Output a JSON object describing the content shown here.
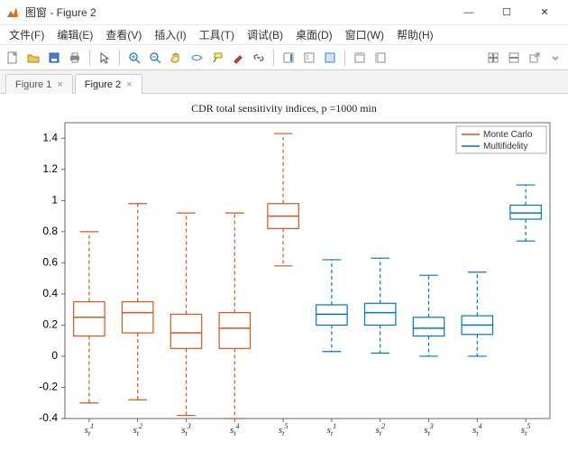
{
  "window": {
    "title": "图窗 - Figure 2",
    "min": "—",
    "max": "☐",
    "close": "✕"
  },
  "menu": {
    "file": "文件(F)",
    "edit": "编辑(E)",
    "view": "查看(V)",
    "insert": "插入(I)",
    "tools": "工具(T)",
    "debug": "调试(B)",
    "desktop": "桌面(D)",
    "window": "窗口(W)",
    "help": "帮助(H)"
  },
  "tabs": {
    "tab1": "Figure 1",
    "tab2": "Figure 2"
  },
  "legend": {
    "mc": "Monte Carlo",
    "mf": "Multifidelity"
  },
  "chart_data": {
    "type": "boxplot",
    "title": "CDR total sensitivity indices, p =1000 min",
    "ylabel": "",
    "xlabel": "",
    "ylim": [
      -0.4,
      1.5
    ],
    "yticks": [
      -0.4,
      -0.2,
      0,
      0.2,
      0.4,
      0.6,
      0.8,
      1,
      1.2,
      1.4
    ],
    "categories": [
      "s_t^1",
      "s_t^2",
      "s_t^3",
      "s_t^4",
      "s_t^5",
      "s_t^1",
      "s_t^2",
      "s_t^3",
      "s_t^4",
      "s_t^5"
    ],
    "series": [
      {
        "name": "Monte Carlo",
        "color": "#d9541e",
        "boxes": [
          {
            "x": 1,
            "whisker_low": -0.3,
            "q1": 0.13,
            "median": 0.25,
            "q3": 0.35,
            "whisker_high": 0.8
          },
          {
            "x": 2,
            "whisker_low": -0.28,
            "q1": 0.15,
            "median": 0.28,
            "q3": 0.35,
            "whisker_high": 0.98
          },
          {
            "x": 3,
            "whisker_low": -0.38,
            "q1": 0.05,
            "median": 0.15,
            "q3": 0.27,
            "whisker_high": 0.92
          },
          {
            "x": 4,
            "whisker_low": -0.4,
            "q1": 0.05,
            "median": 0.18,
            "q3": 0.28,
            "whisker_high": 0.92
          },
          {
            "x": 5,
            "whisker_low": 0.58,
            "q1": 0.82,
            "median": 0.9,
            "q3": 0.98,
            "whisker_high": 1.43
          }
        ]
      },
      {
        "name": "Multifidelity",
        "color": "#0076c0",
        "boxes": [
          {
            "x": 6,
            "whisker_low": 0.03,
            "q1": 0.2,
            "median": 0.27,
            "q3": 0.33,
            "whisker_high": 0.62
          },
          {
            "x": 7,
            "whisker_low": 0.02,
            "q1": 0.2,
            "median": 0.28,
            "q3": 0.34,
            "whisker_high": 0.63
          },
          {
            "x": 8,
            "whisker_low": 0.0,
            "q1": 0.13,
            "median": 0.18,
            "q3": 0.25,
            "whisker_high": 0.52
          },
          {
            "x": 9,
            "whisker_low": 0.0,
            "q1": 0.14,
            "median": 0.2,
            "q3": 0.26,
            "whisker_high": 0.54
          },
          {
            "x": 10,
            "whisker_low": 0.74,
            "q1": 0.88,
            "median": 0.92,
            "q3": 0.97,
            "whisker_high": 1.1
          }
        ]
      }
    ]
  },
  "colors": {
    "mc": "#d9541e",
    "mf": "#0076c0"
  }
}
